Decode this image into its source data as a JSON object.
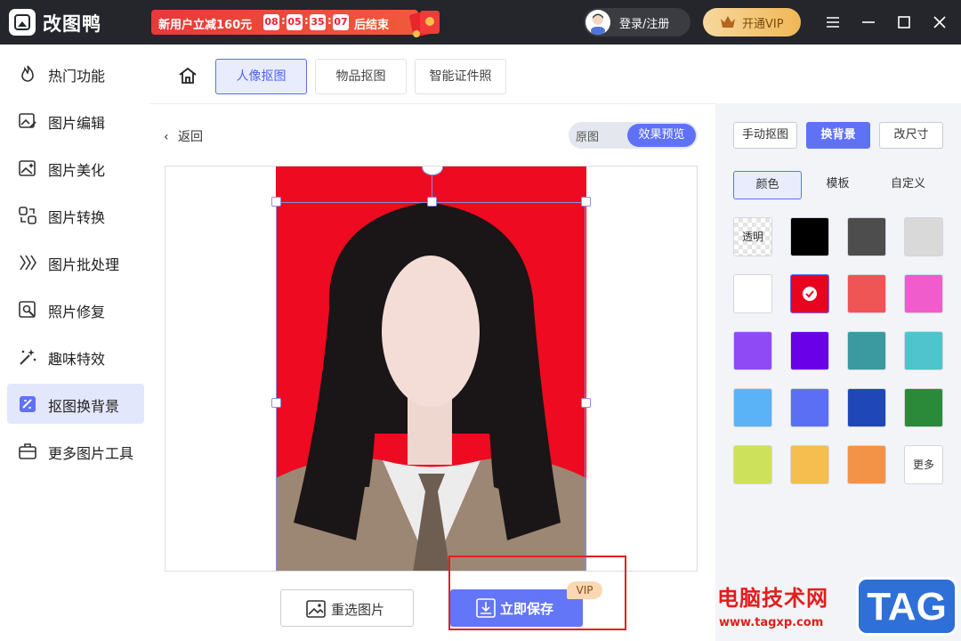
{
  "app": {
    "title": "改图鸭"
  },
  "promo": {
    "text": "新用户立减160元",
    "timer": [
      "08",
      "05",
      "35",
      "07"
    ],
    "end_text": "后结束"
  },
  "header": {
    "login_label": "登录/注册",
    "vip_label": "开通VIP"
  },
  "sidebar": {
    "items": [
      {
        "label": "热门功能",
        "icon": "fire-icon"
      },
      {
        "label": "图片编辑",
        "icon": "image-edit-icon"
      },
      {
        "label": "图片美化",
        "icon": "image-beautify-icon"
      },
      {
        "label": "图片转换",
        "icon": "convert-icon"
      },
      {
        "label": "图片批处理",
        "icon": "batch-icon"
      },
      {
        "label": "照片修复",
        "icon": "repair-icon"
      },
      {
        "label": "趣味特效",
        "icon": "magic-wand-icon"
      },
      {
        "label": "抠图换背景",
        "icon": "cutout-icon"
      },
      {
        "label": "更多图片工具",
        "icon": "toolbox-icon"
      }
    ],
    "active_index": 7
  },
  "tabs": {
    "items": [
      "人像抠图",
      "物品抠图",
      "智能证件照"
    ],
    "active_index": 0
  },
  "main": {
    "back_label": "返回",
    "toggle_original": "原图",
    "toggle_preview": "效果预览",
    "reselect_label": "重选图片",
    "save_label": "立即保存",
    "vip_tag": "VIP"
  },
  "right_panel": {
    "mode_buttons": [
      "手动抠图",
      "换背景",
      "改尺寸"
    ],
    "active_mode": 1,
    "subtabs": [
      "颜色",
      "模板",
      "自定义"
    ],
    "active_subtab": 0,
    "swatches": [
      {
        "label": "透明",
        "color": "transparent"
      },
      {
        "color": "#000000"
      },
      {
        "color": "#4d4d4d"
      },
      {
        "color": "#d9d9d9"
      },
      {
        "color": "#ffffff"
      },
      {
        "color": "#e8041f",
        "selected": true
      },
      {
        "color": "#f05555"
      },
      {
        "color": "#f05ccb"
      },
      {
        "color": "#8f4af5"
      },
      {
        "color": "#6a00e8"
      },
      {
        "color": "#3a9aa0"
      },
      {
        "color": "#4fc4cc"
      },
      {
        "color": "#5ab3f7"
      },
      {
        "color": "#5b6ff5"
      },
      {
        "color": "#1f47b8"
      },
      {
        "color": "#2b8a3a"
      },
      {
        "color": "#cde25a"
      },
      {
        "color": "#f5be4e"
      },
      {
        "color": "#f39347"
      },
      {
        "label": "更多",
        "color": "#ffffff"
      }
    ]
  },
  "watermark": {
    "title": "电脑技术网",
    "url": "www.tagxp.com",
    "tag": "TAG"
  }
}
